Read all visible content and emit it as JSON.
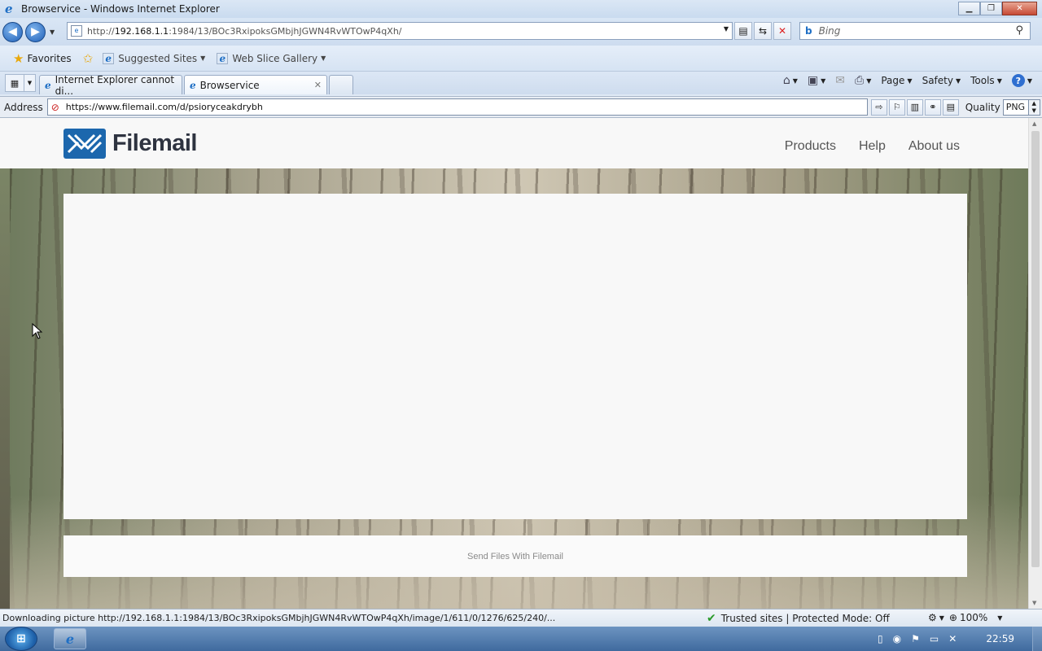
{
  "window": {
    "title": "Browservice - Windows Internet Explorer"
  },
  "nav": {
    "url_prefix": "http://",
    "url_host": "192.168.1.1",
    "url_rest": ":1984/13/BOc3RxipoksGMbjhJGWN4RvWTOwP4qXh/",
    "search_placeholder": "Bing"
  },
  "favorites": {
    "favorites_label": "Favorites",
    "suggested_sites": "Suggested Sites",
    "web_slice_gallery": "Web Slice Gallery"
  },
  "tabs": [
    {
      "label": "Internet Explorer cannot di..."
    },
    {
      "label": "Browservice"
    }
  ],
  "commandbar": {
    "page": "Page",
    "safety": "Safety",
    "tools": "Tools"
  },
  "addressbar": {
    "label": "Address",
    "url": "https://www.filemail.com/d/psioryceakdrybh",
    "quality_label": "Quality",
    "quality_value": "PNG"
  },
  "site": {
    "logo_text": "Filemail",
    "nav": [
      "Products",
      "Help",
      "About us"
    ],
    "footer_text": "Send Files With Filemail"
  },
  "status": {
    "text": "Downloading picture http://192.168.1.1:1984/13/BOc3RxipoksGMbjhJGWN4RvWTOwP4qXh/image/1/611/0/1276/625/240/...",
    "zone": "Trusted sites | Protected Mode: Off",
    "zoom": "100%"
  },
  "taskbar": {
    "clock": "22:59"
  },
  "colors": {
    "filemail_blue": "#1c67ad",
    "title_bar": "#cfdff2",
    "taskbar": "#4f78a9"
  }
}
